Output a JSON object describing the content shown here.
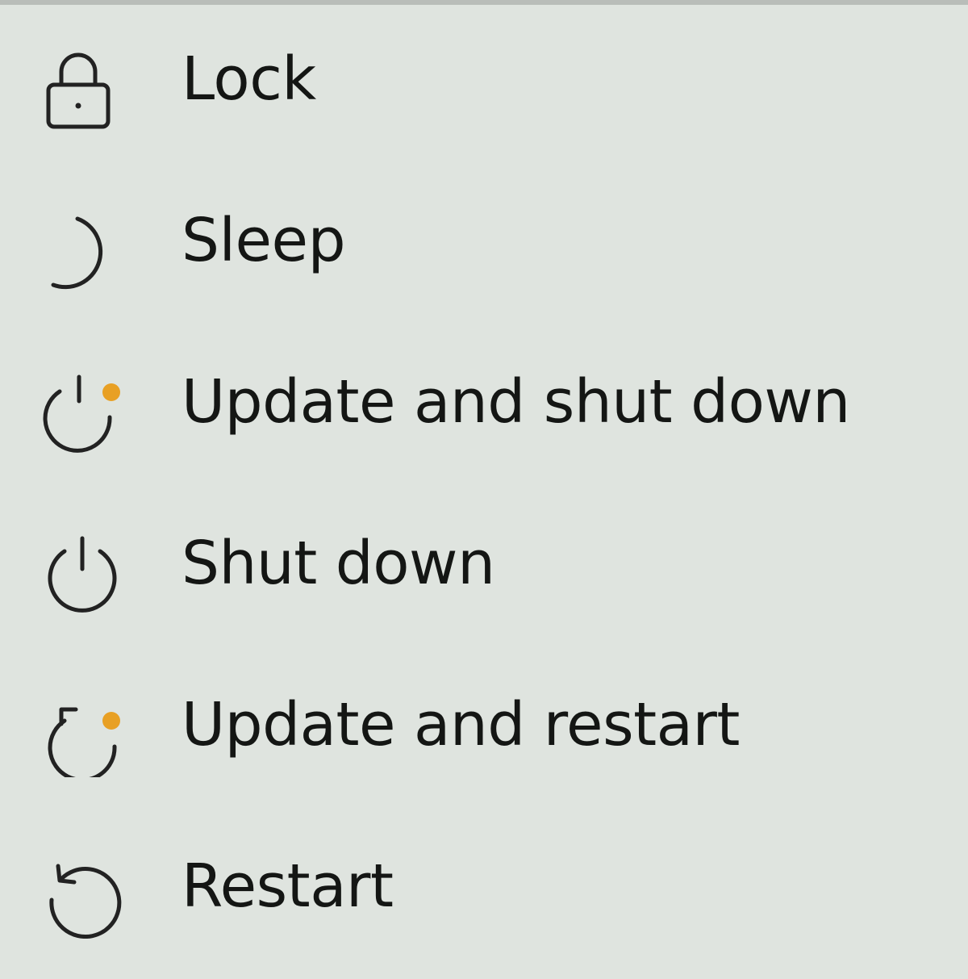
{
  "power_menu": {
    "accent_color": "#e8a024",
    "items": [
      {
        "label": "Lock",
        "icon": "lock-icon"
      },
      {
        "label": "Sleep",
        "icon": "moon-icon"
      },
      {
        "label": "Update and shut down",
        "icon": "update-power-icon"
      },
      {
        "label": "Shut down",
        "icon": "power-icon"
      },
      {
        "label": "Update and restart",
        "icon": "update-restart-icon"
      },
      {
        "label": "Restart",
        "icon": "restart-icon"
      }
    ]
  }
}
